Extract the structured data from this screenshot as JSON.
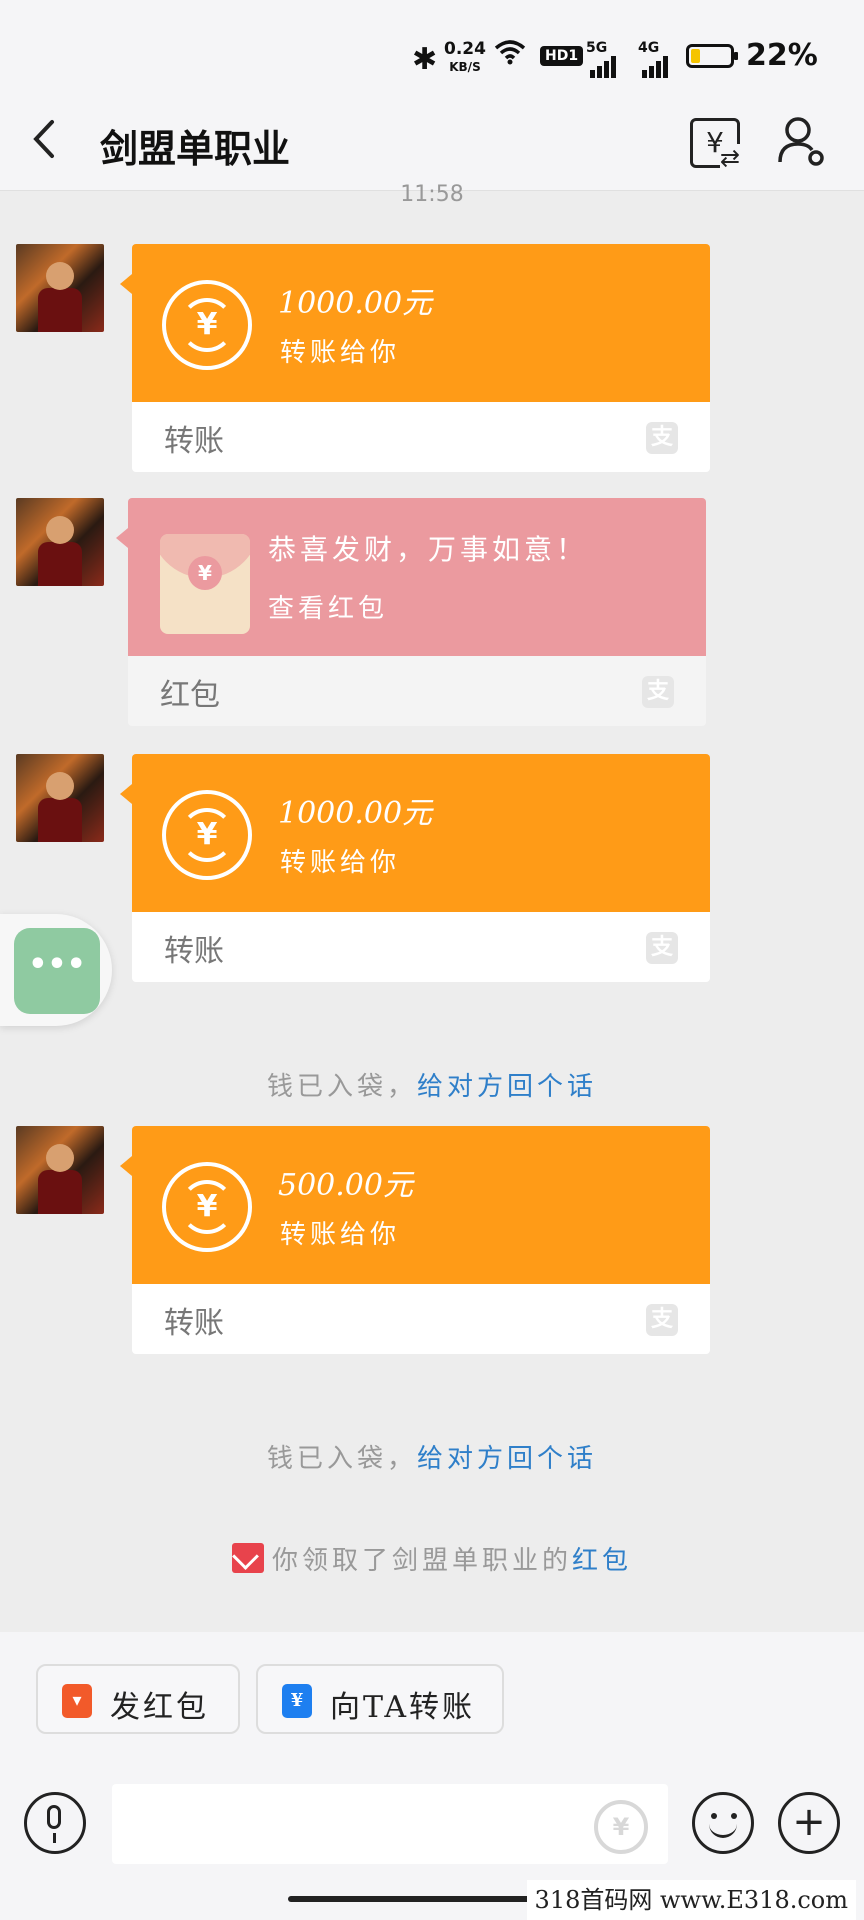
{
  "status_bar": {
    "bluetooth_icon": "bluetooth-icon",
    "speed_value": "0.24",
    "speed_unit": "KB/S",
    "hd_badge": "HD1",
    "network_5g": "5G",
    "network_4g": "4G",
    "battery_level": 0.22,
    "battery_color": "#f5c400",
    "battery_percent": "22%"
  },
  "header": {
    "title": "剑盟单职业",
    "back_icon": "back-arrow-icon",
    "transfer_icon": "yen-transfer-icon",
    "profile_icon": "user-settings-icon",
    "time_peek": "11:58"
  },
  "messages": [
    {
      "type": "transfer",
      "amount": "1000.00元",
      "desc": "转账给你",
      "label": "转账"
    },
    {
      "type": "red_packet",
      "greeting": "恭喜发财，万事如意！",
      "action": "查看红包",
      "label": "红包"
    },
    {
      "type": "transfer",
      "amount": "1000.00元",
      "desc": "转账给你",
      "label": "转账"
    },
    {
      "type": "system",
      "text": "钱已入袋，",
      "link": "给对方回个话"
    },
    {
      "type": "transfer",
      "amount": "500.00元",
      "desc": "转账给你",
      "label": "转账"
    },
    {
      "type": "system",
      "text": "钱已入袋，",
      "link": "给对方回个话"
    },
    {
      "type": "system_redpacket",
      "text": "你领取了剑盟单职业的",
      "link": "红包"
    }
  ],
  "quick_actions": {
    "send_red_packet": "发红包",
    "transfer_to": "向TA转账"
  },
  "input": {
    "value": "",
    "placeholder": ""
  },
  "colors": {
    "transfer": "#ff9b17",
    "red_packet": "#eb9a9f",
    "link": "#2f7fc9",
    "float_button": "#8fcaa1"
  },
  "watermark": "318首码网  www.E318.com"
}
